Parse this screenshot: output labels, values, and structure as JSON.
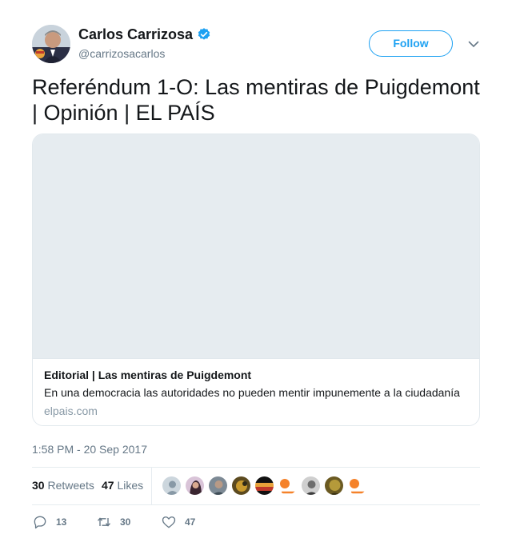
{
  "author": {
    "name": "Carlos Carrizosa",
    "handle": "@carrizosacarlos",
    "verified": true,
    "follow_label": "Follow"
  },
  "tweet": {
    "text": "Referéndum 1-O: Las mentiras de Puigdemont | Opinión | EL PAÍS"
  },
  "card": {
    "title": "Editorial | Las mentiras de Puigdemont",
    "description": "En una democracia las autoridades no pueden mentir impunemente a la ciudadanía",
    "domain": "elpais.com"
  },
  "timestamp": "1:58 PM - 20 Sep 2017",
  "stats": {
    "retweets_count": "30",
    "retweets_label": "Retweets",
    "likes_count": "47",
    "likes_label": "Likes"
  },
  "actions": {
    "replies": "13",
    "retweets": "30",
    "likes": "47"
  },
  "icons": [
    "verified-badge-icon",
    "chevron-down-icon",
    "reply-icon",
    "retweet-icon",
    "heart-icon"
  ],
  "colors": {
    "accent": "#1da1f2",
    "muted": "#657786",
    "divider": "#e6ecf0"
  }
}
